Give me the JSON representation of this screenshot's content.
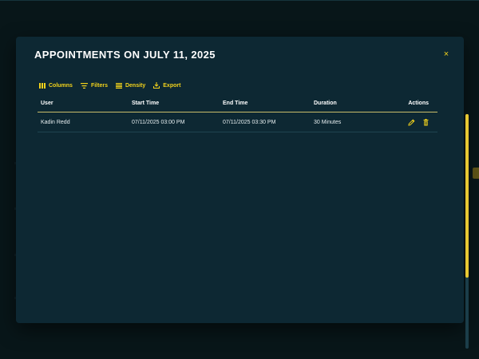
{
  "modal": {
    "title": "APPOINTMENTS ON JULY 11, 2025",
    "close_label": "×"
  },
  "toolbar": {
    "columns_label": "Columns",
    "filters_label": "Filters",
    "density_label": "Density",
    "export_label": "Export"
  },
  "grid": {
    "headers": {
      "user": "User",
      "start": "Start Time",
      "end": "End Time",
      "duration": "Duration",
      "actions": "Actions"
    },
    "rows": [
      {
        "user": "Kadin Redd",
        "start": "07/11/2025 03:00 PM",
        "end": "07/11/2025 03:30 PM",
        "duration": "30 Minutes"
      }
    ]
  },
  "icons": {
    "toolbar": [
      "columns-icon",
      "filter-icon",
      "density-icon",
      "export-icon"
    ],
    "row_actions": [
      "edit-icon",
      "delete-icon"
    ],
    "close": "close-icon"
  },
  "colors": {
    "accent": "#f2d21b",
    "modal_bg": "#0d2833",
    "page_bg": "#081619",
    "text": "#ffffff"
  }
}
